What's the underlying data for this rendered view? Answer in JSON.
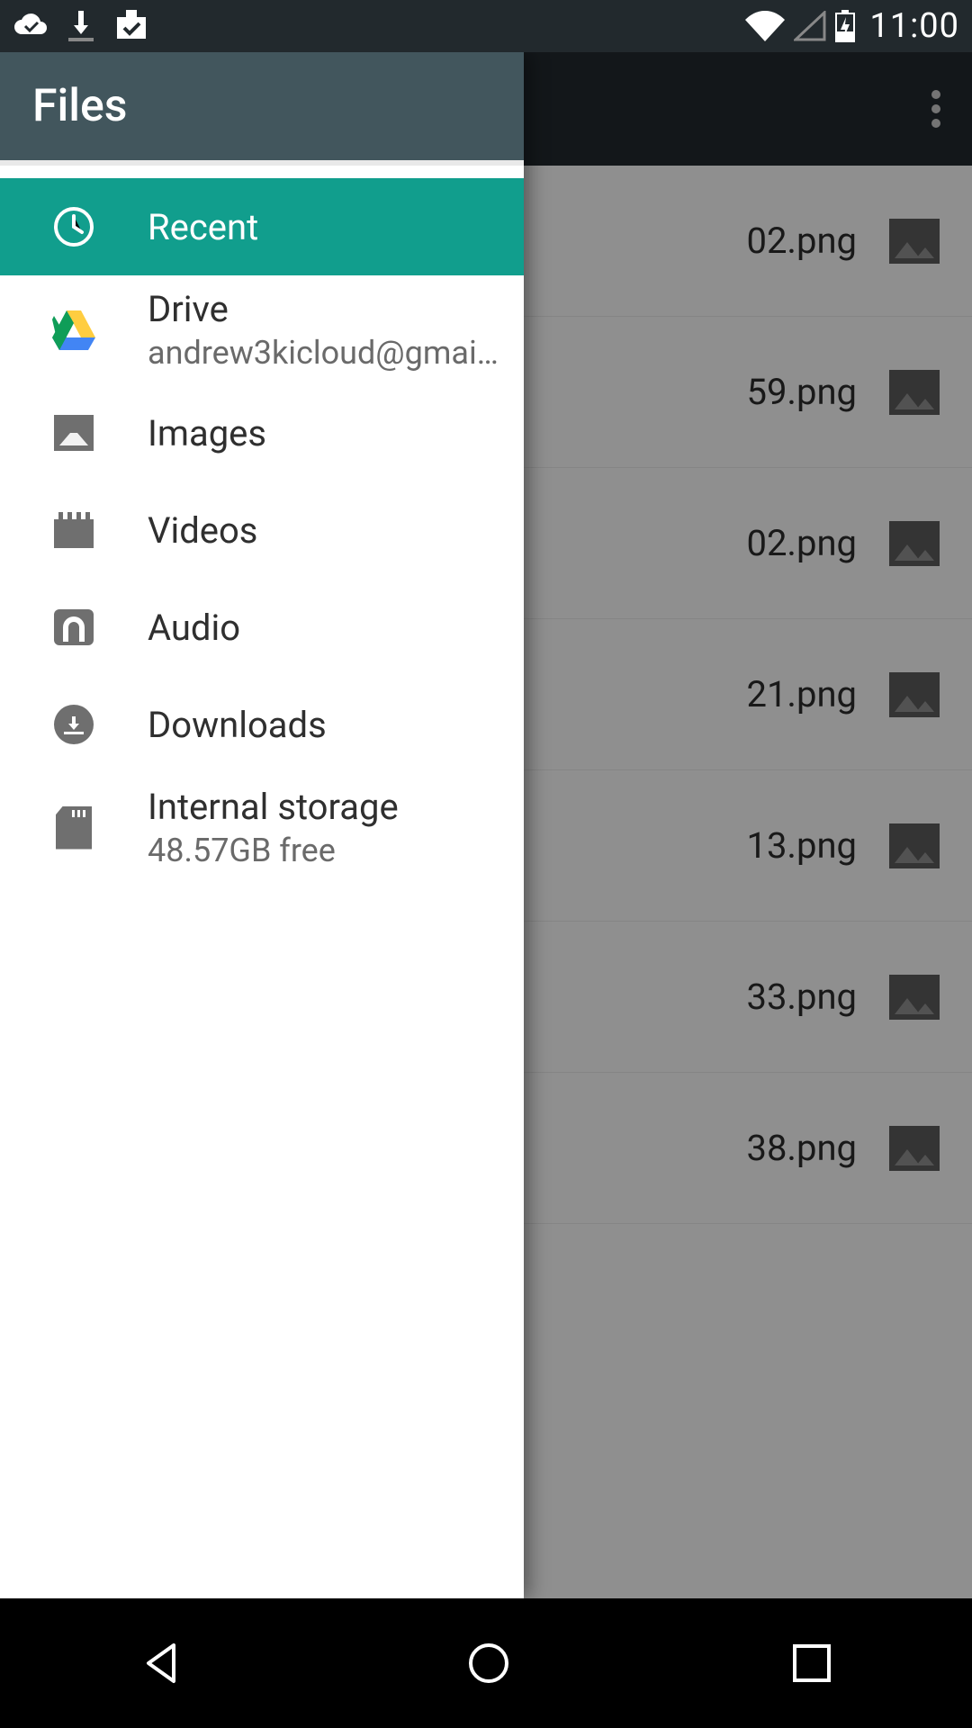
{
  "status": {
    "time": "11:00"
  },
  "overflow_menu": "More options",
  "drawer": {
    "title": "Files",
    "items": [
      {
        "icon": "clock",
        "label": "Recent",
        "sub": null,
        "active": true
      },
      {
        "icon": "drive",
        "label": "Drive",
        "sub": "andrew3kicloud@gmail.c…",
        "active": false
      },
      {
        "icon": "images",
        "label": "Images",
        "sub": null,
        "active": false
      },
      {
        "icon": "videos",
        "label": "Videos",
        "sub": null,
        "active": false
      },
      {
        "icon": "audio",
        "label": "Audio",
        "sub": null,
        "active": false
      },
      {
        "icon": "download",
        "label": "Downloads",
        "sub": null,
        "active": false
      },
      {
        "icon": "sd",
        "label": "Internal storage",
        "sub": "48.57GB free",
        "active": false
      }
    ]
  },
  "files_visible": [
    {
      "suffix": "02.png"
    },
    {
      "suffix": "59.png"
    },
    {
      "suffix": "02.png"
    },
    {
      "suffix": "21.png"
    },
    {
      "suffix": "13.png"
    },
    {
      "suffix": "33.png"
    },
    {
      "suffix": "38.png"
    }
  ]
}
